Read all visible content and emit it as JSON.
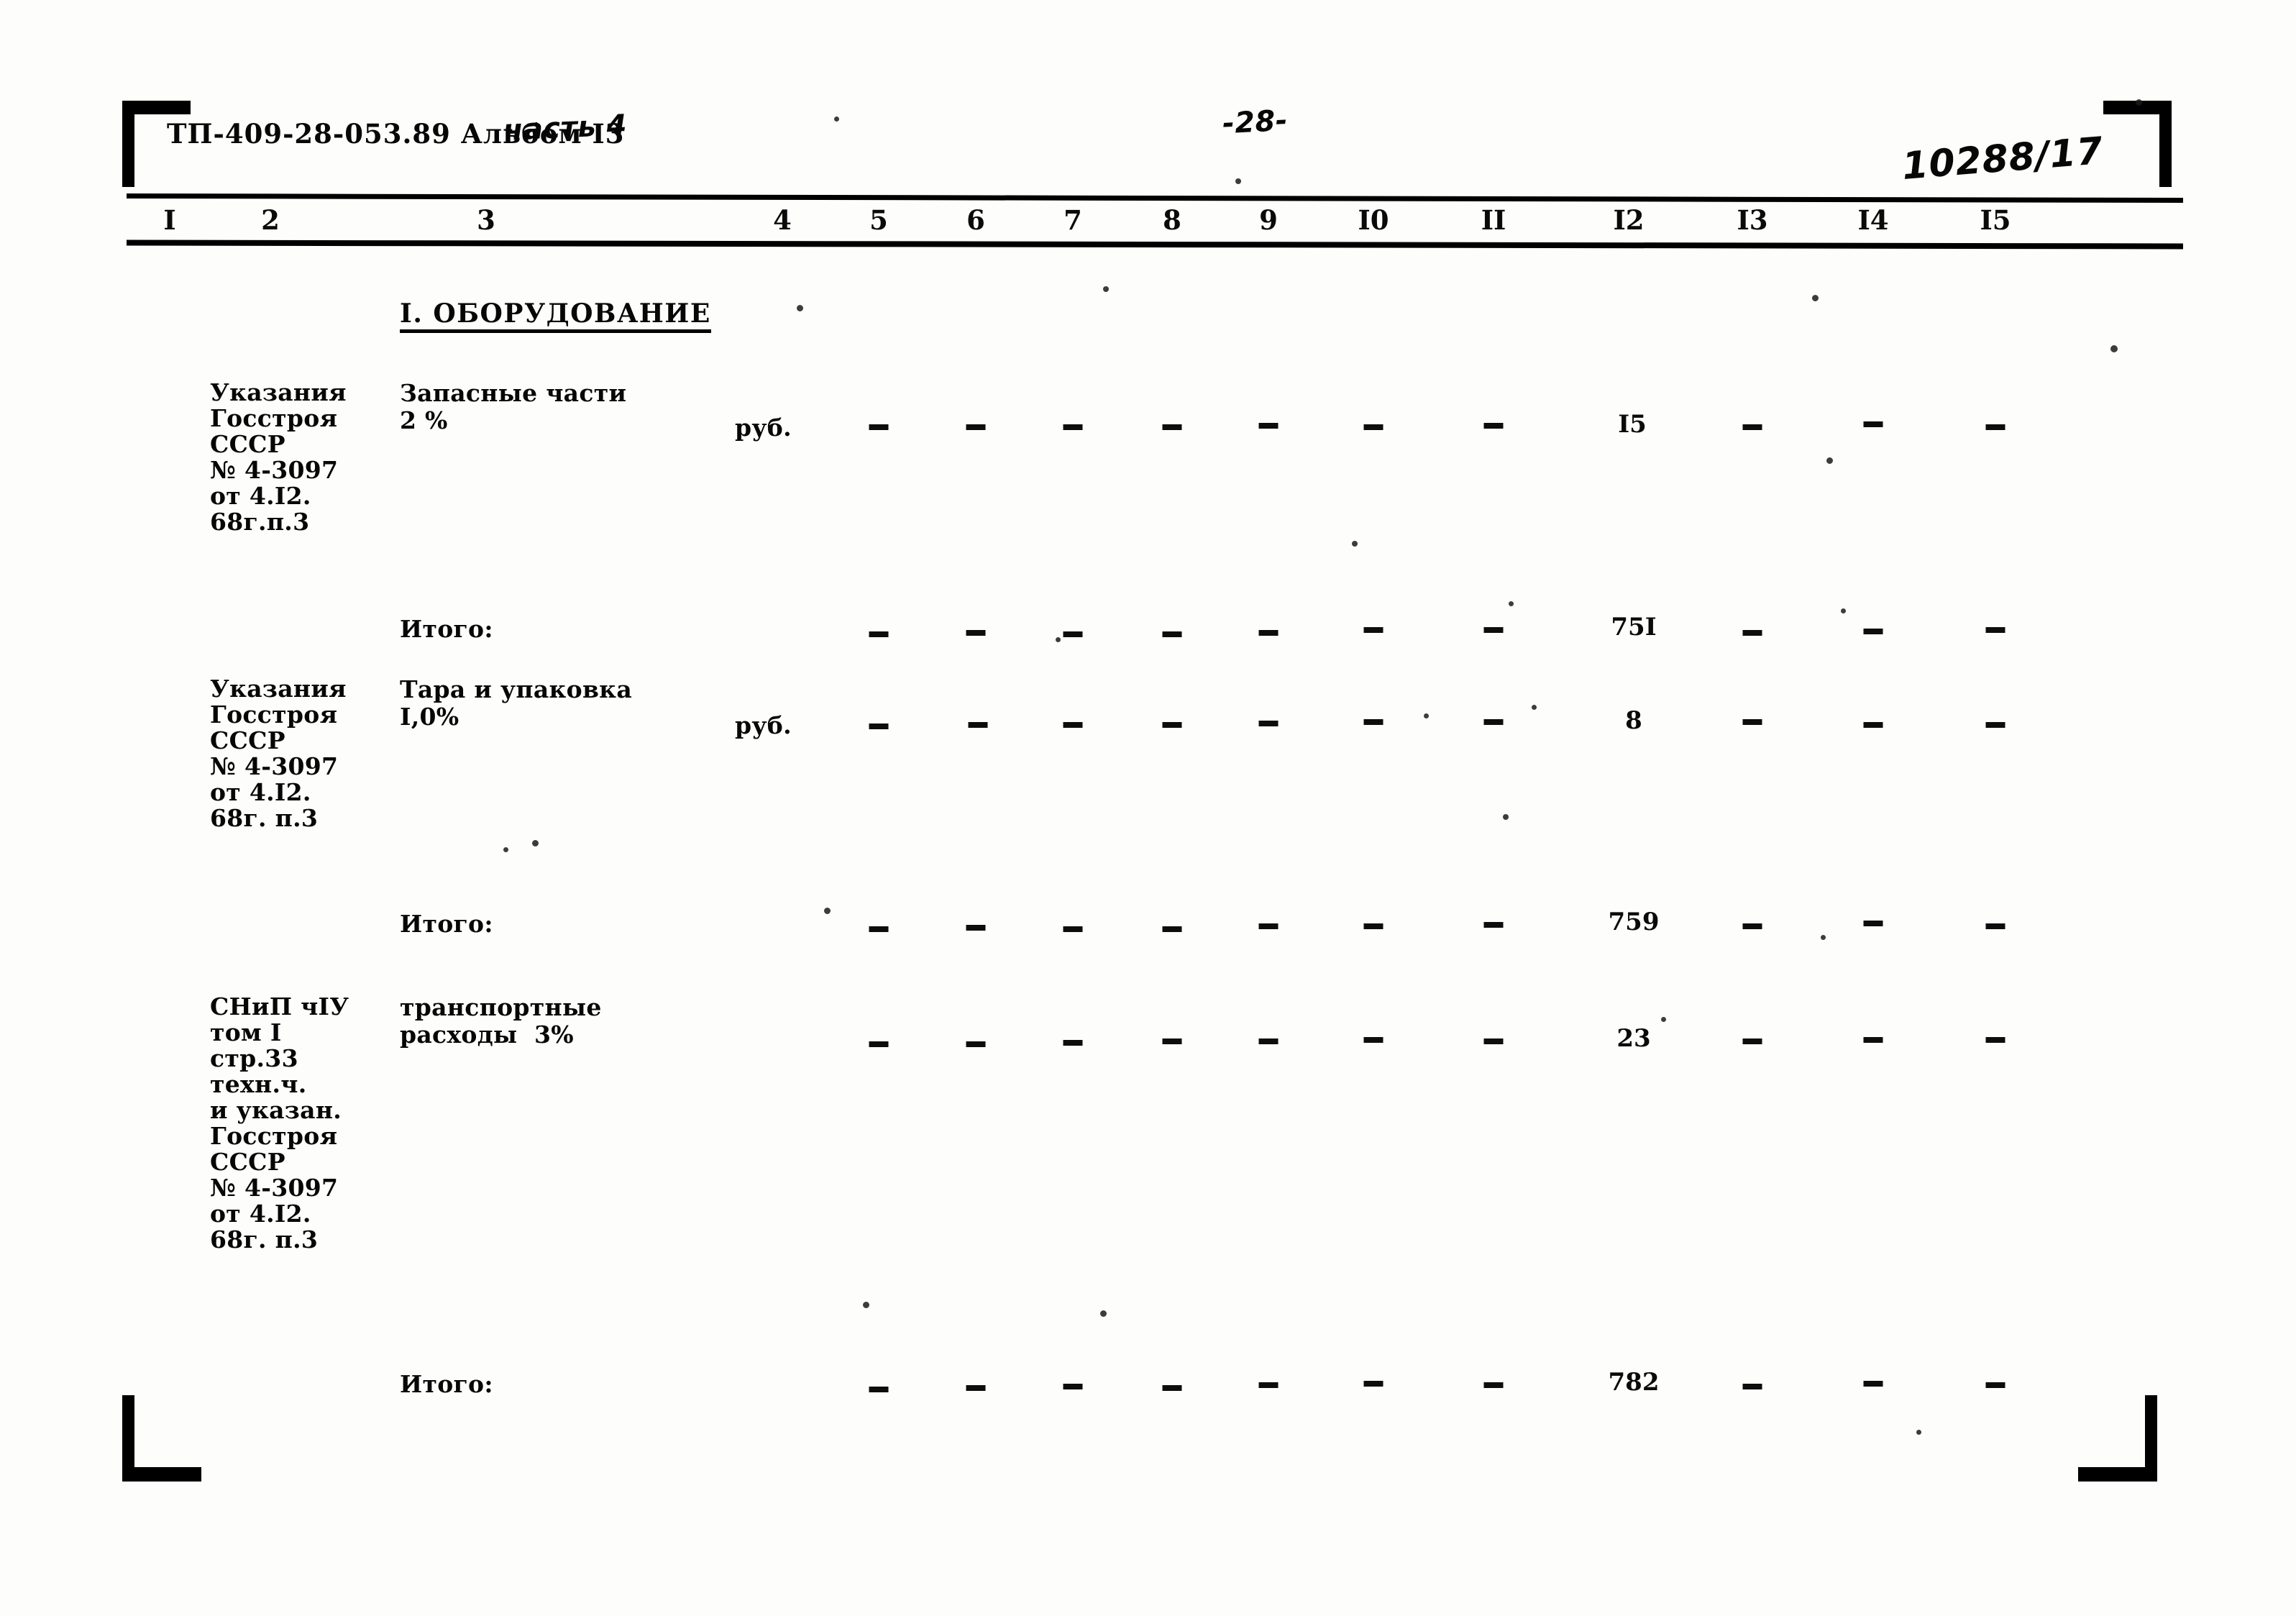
{
  "document": {
    "code": "ТП-409-28-053.89 Альбом I3",
    "part": "часть 4",
    "page_number": "-28-",
    "archive_stamp": "10288/17"
  },
  "table": {
    "column_numbers": [
      "I",
      "2",
      "3",
      "4",
      "5",
      "6",
      "7",
      "8",
      "9",
      "I0",
      "II",
      "I2",
      "I3",
      "I4",
      "I5"
    ],
    "section_title": "I. ОБОРУДОВАНИЕ",
    "total_label": "Итого:",
    "dash_symbol": "-",
    "rows": [
      {
        "reference": "Указания\nГосстроя\nСССР\n№ 4-3097\nот 4.I2.\n68г.п.3",
        "name": "Запасные части\n2 %",
        "unit": "руб.",
        "value_col12": "I5",
        "total": "75I"
      },
      {
        "reference": "Указания\nГосстроя\nСССР\n№ 4-3097\nот 4.I2.\n68г. п.3",
        "name": "Тара и упаковка\nI,0%",
        "unit": "руб.",
        "value_col12": "8",
        "total": "759"
      },
      {
        "reference": "СНиП чIУ\nтом I\nстр.33\nтехн.ч.\nи указан.\nГосстроя\nСССР\n№ 4-3097\nот 4.I2.\n68г. п.3",
        "name": "транспортные\nрасходы  3%",
        "unit": "",
        "value_col12": "23",
        "total": "782"
      }
    ]
  },
  "colors": {
    "ink": "#0a0a0a",
    "paper": "#fdfdfb"
  }
}
